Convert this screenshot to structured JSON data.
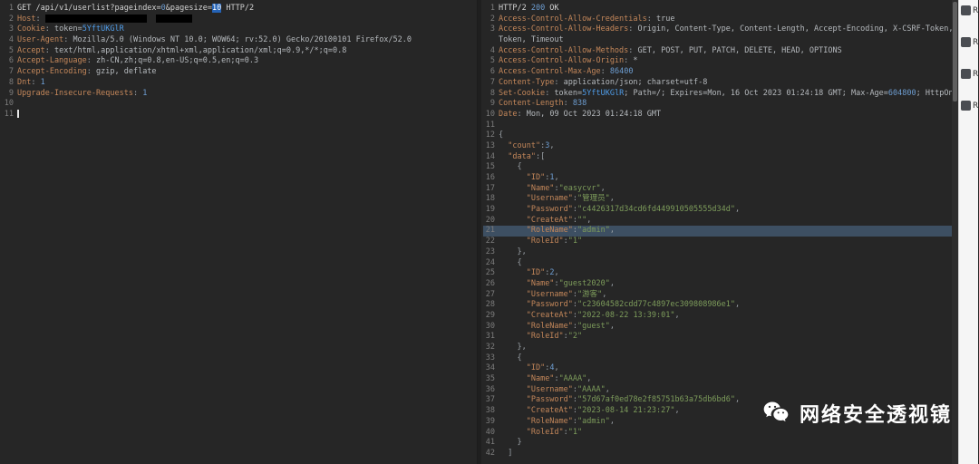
{
  "request": {
    "lines": [
      {
        "n": "1",
        "t": [
          [
            "GET ",
            "p"
          ],
          [
            "/api/v1/userlist?",
            "p"
          ],
          [
            "pageindex=",
            "p"
          ],
          [
            "0",
            "num"
          ],
          [
            "&pagesize=",
            "p"
          ],
          [
            "10",
            "selv"
          ],
          [
            " HTTP/2",
            "p"
          ]
        ]
      },
      {
        "n": "2",
        "t": [
          [
            "Host",
            "hn"
          ],
          [
            ": ",
            "pu"
          ],
          [
            "",
            "rd",
            112
          ],
          [
            "  ",
            "pu"
          ],
          [
            "",
            "rd",
            40
          ]
        ]
      },
      {
        "n": "3",
        "t": [
          [
            "Cookie",
            "hn"
          ],
          [
            ": ",
            "pu"
          ],
          [
            "token=",
            "v"
          ],
          [
            "5YftUKGlR",
            "tok"
          ]
        ]
      },
      {
        "n": "4",
        "t": [
          [
            "User-Agent",
            "hn"
          ],
          [
            ": ",
            "pu"
          ],
          [
            "Mozilla/5.0 (Windows NT 10.0; WOW64; rv:52.0) Gecko/20100101 Firefox/52.0",
            "v"
          ]
        ]
      },
      {
        "n": "5",
        "t": [
          [
            "Accept",
            "hn"
          ],
          [
            ": ",
            "pu"
          ],
          [
            "text/html,application/xhtml+xml,application/xml;q=0.9,*/*;q=0.8",
            "v"
          ]
        ]
      },
      {
        "n": "6",
        "t": [
          [
            "Accept-Language",
            "hn"
          ],
          [
            ": ",
            "pu"
          ],
          [
            "zh-CN,zh;q=0.8,en-US;q=0.5,en;q=0.3",
            "v"
          ]
        ]
      },
      {
        "n": "7",
        "t": [
          [
            "Accept-Encoding",
            "hn"
          ],
          [
            ": ",
            "pu"
          ],
          [
            "gzip, deflate",
            "v"
          ]
        ]
      },
      {
        "n": "8",
        "t": [
          [
            "Dnt",
            "hn"
          ],
          [
            ": ",
            "pu"
          ],
          [
            "1",
            "num"
          ]
        ]
      },
      {
        "n": "9",
        "t": [
          [
            "Upgrade-Insecure-Requests",
            "hn"
          ],
          [
            ": ",
            "pu"
          ],
          [
            "1",
            "num"
          ]
        ]
      },
      {
        "n": "10",
        "t": []
      },
      {
        "n": "11",
        "t": [],
        "cursor": true
      }
    ]
  },
  "response": {
    "lines": [
      {
        "n": "1",
        "t": [
          [
            "HTTP/2 ",
            "p"
          ],
          [
            "200",
            "num"
          ],
          [
            " OK",
            "p"
          ]
        ]
      },
      {
        "n": "2",
        "t": [
          [
            "Access-Control-Allow-Credentials",
            "hn"
          ],
          [
            ": ",
            "pu"
          ],
          [
            "true",
            "v"
          ]
        ]
      },
      {
        "n": "3",
        "t": [
          [
            "Access-Control-Allow-Headers",
            "hn"
          ],
          [
            ": ",
            "pu"
          ],
          [
            "Origin, Content-Type, Content-Length, Accept-Encoding, X-CSRF-Token,",
            "v"
          ]
        ]
      },
      {
        "n": "",
        "t": [
          [
            "Token, Timeout",
            "v"
          ]
        ]
      },
      {
        "n": "4",
        "t": [
          [
            "Access-Control-Allow-Methods",
            "hn"
          ],
          [
            ": ",
            "pu"
          ],
          [
            "GET, POST, PUT, PATCH, DELETE, HEAD, OPTIONS",
            "v"
          ]
        ]
      },
      {
        "n": "5",
        "t": [
          [
            "Access-Control-Allow-Origin",
            "hn"
          ],
          [
            ": ",
            "pu"
          ],
          [
            "*",
            "v"
          ]
        ]
      },
      {
        "n": "6",
        "t": [
          [
            "Access-Control-Max-Age",
            "hn"
          ],
          [
            ": ",
            "pu"
          ],
          [
            "86400",
            "num"
          ]
        ]
      },
      {
        "n": "7",
        "t": [
          [
            "Content-Type",
            "hn"
          ],
          [
            ": ",
            "pu"
          ],
          [
            "application/json; charset=utf-8",
            "v"
          ]
        ]
      },
      {
        "n": "8",
        "t": [
          [
            "Set-Cookie",
            "hn"
          ],
          [
            ": ",
            "pu"
          ],
          [
            "token=",
            "v"
          ],
          [
            "5YftUKGlR",
            "tok"
          ],
          [
            "; Path=/; Expires=Mon, 16 Oct 2023 01:24:18 GMT; Max-Age=",
            "v"
          ],
          [
            "604800",
            "num"
          ],
          [
            "; HttpOnly",
            "v"
          ]
        ]
      },
      {
        "n": "9",
        "t": [
          [
            "Content-Length",
            "hn"
          ],
          [
            ": ",
            "pu"
          ],
          [
            "838",
            "num"
          ]
        ]
      },
      {
        "n": "10",
        "t": [
          [
            "Date",
            "hn"
          ],
          [
            ": ",
            "pu"
          ],
          [
            "Mon, 09 Oct 2023 01:24:18 GMT",
            "v"
          ]
        ]
      },
      {
        "n": "11",
        "t": []
      },
      {
        "n": "12",
        "t": [
          [
            "{",
            "pu"
          ]
        ]
      },
      {
        "n": "13",
        "t": [
          [
            "  ",
            "p"
          ],
          [
            "\"count\"",
            "key"
          ],
          [
            ":",
            "pu"
          ],
          [
            "3",
            "num"
          ],
          [
            ",",
            "pu"
          ]
        ]
      },
      {
        "n": "14",
        "t": [
          [
            "  ",
            "p"
          ],
          [
            "\"data\"",
            "key"
          ],
          [
            ":[",
            "pu"
          ]
        ]
      },
      {
        "n": "15",
        "t": [
          [
            "    {",
            "pu"
          ]
        ]
      },
      {
        "n": "16",
        "t": [
          [
            "      ",
            "p"
          ],
          [
            "\"ID\"",
            "key"
          ],
          [
            ":",
            "pu"
          ],
          [
            "1",
            "num"
          ],
          [
            ",",
            "pu"
          ]
        ]
      },
      {
        "n": "17",
        "t": [
          [
            "      ",
            "p"
          ],
          [
            "\"Name\"",
            "key"
          ],
          [
            ":",
            "pu"
          ],
          [
            "\"easycvr\"",
            "str"
          ],
          [
            ",",
            "pu"
          ]
        ]
      },
      {
        "n": "18",
        "t": [
          [
            "      ",
            "p"
          ],
          [
            "\"Username\"",
            "key"
          ],
          [
            ":",
            "pu"
          ],
          [
            "\"管理员\"",
            "str"
          ],
          [
            ",",
            "pu"
          ]
        ]
      },
      {
        "n": "19",
        "t": [
          [
            "      ",
            "p"
          ],
          [
            "\"Password\"",
            "key"
          ],
          [
            ":",
            "pu"
          ],
          [
            "\"c4426317d34cd6fd449910505555d34d\"",
            "str"
          ],
          [
            ",",
            "pu"
          ]
        ]
      },
      {
        "n": "20",
        "t": [
          [
            "      ",
            "p"
          ],
          [
            "\"CreateAt\"",
            "key"
          ],
          [
            ":",
            "pu"
          ],
          [
            "\"\"",
            "str"
          ],
          [
            ",",
            "pu"
          ]
        ]
      },
      {
        "n": "21",
        "hl": true,
        "t": [
          [
            "      ",
            "p"
          ],
          [
            "\"RoleName\"",
            "key"
          ],
          [
            ":",
            "pu"
          ],
          [
            "\"admin\"",
            "str"
          ],
          [
            ",",
            "pu"
          ]
        ]
      },
      {
        "n": "22",
        "t": [
          [
            "      ",
            "p"
          ],
          [
            "\"RoleId\"",
            "key"
          ],
          [
            ":",
            "pu"
          ],
          [
            "\"1\"",
            "str"
          ]
        ]
      },
      {
        "n": "23",
        "t": [
          [
            "    },",
            "pu"
          ]
        ]
      },
      {
        "n": "24",
        "t": [
          [
            "    {",
            "pu"
          ]
        ]
      },
      {
        "n": "25",
        "t": [
          [
            "      ",
            "p"
          ],
          [
            "\"ID\"",
            "key"
          ],
          [
            ":",
            "pu"
          ],
          [
            "2",
            "num"
          ],
          [
            ",",
            "pu"
          ]
        ]
      },
      {
        "n": "26",
        "t": [
          [
            "      ",
            "p"
          ],
          [
            "\"Name\"",
            "key"
          ],
          [
            ":",
            "pu"
          ],
          [
            "\"guest2020\"",
            "str"
          ],
          [
            ",",
            "pu"
          ]
        ]
      },
      {
        "n": "27",
        "t": [
          [
            "      ",
            "p"
          ],
          [
            "\"Username\"",
            "key"
          ],
          [
            ":",
            "pu"
          ],
          [
            "\"游客\"",
            "str"
          ],
          [
            ",",
            "pu"
          ]
        ]
      },
      {
        "n": "28",
        "t": [
          [
            "      ",
            "p"
          ],
          [
            "\"Password\"",
            "key"
          ],
          [
            ":",
            "pu"
          ],
          [
            "\"c23604582cdd77c4897ec309808986e1\"",
            "str"
          ],
          [
            ",",
            "pu"
          ]
        ]
      },
      {
        "n": "29",
        "t": [
          [
            "      ",
            "p"
          ],
          [
            "\"CreateAt\"",
            "key"
          ],
          [
            ":",
            "pu"
          ],
          [
            "\"2022-08-22 13:39:01\"",
            "str"
          ],
          [
            ",",
            "pu"
          ]
        ]
      },
      {
        "n": "30",
        "t": [
          [
            "      ",
            "p"
          ],
          [
            "\"RoleName\"",
            "key"
          ],
          [
            ":",
            "pu"
          ],
          [
            "\"guest\"",
            "str"
          ],
          [
            ",",
            "pu"
          ]
        ]
      },
      {
        "n": "31",
        "t": [
          [
            "      ",
            "p"
          ],
          [
            "\"RoleId\"",
            "key"
          ],
          [
            ":",
            "pu"
          ],
          [
            "\"2\"",
            "str"
          ]
        ]
      },
      {
        "n": "32",
        "t": [
          [
            "    },",
            "pu"
          ]
        ]
      },
      {
        "n": "33",
        "t": [
          [
            "    {",
            "pu"
          ]
        ]
      },
      {
        "n": "34",
        "t": [
          [
            "      ",
            "p"
          ],
          [
            "\"ID\"",
            "key"
          ],
          [
            ":",
            "pu"
          ],
          [
            "4",
            "num"
          ],
          [
            ",",
            "pu"
          ]
        ]
      },
      {
        "n": "35",
        "t": [
          [
            "      ",
            "p"
          ],
          [
            "\"Name\"",
            "key"
          ],
          [
            ":",
            "pu"
          ],
          [
            "\"AAAA\"",
            "str"
          ],
          [
            ",",
            "pu"
          ]
        ]
      },
      {
        "n": "36",
        "t": [
          [
            "      ",
            "p"
          ],
          [
            "\"Username\"",
            "key"
          ],
          [
            ":",
            "pu"
          ],
          [
            "\"AAAA\"",
            "str"
          ],
          [
            ",",
            "pu"
          ]
        ]
      },
      {
        "n": "37",
        "t": [
          [
            "      ",
            "p"
          ],
          [
            "\"Password\"",
            "key"
          ],
          [
            ":",
            "pu"
          ],
          [
            "\"57d67af0ed78e2f85751b63a75db6bd6\"",
            "str"
          ],
          [
            ",",
            "pu"
          ]
        ]
      },
      {
        "n": "38",
        "t": [
          [
            "      ",
            "p"
          ],
          [
            "\"CreateAt\"",
            "key"
          ],
          [
            ":",
            "pu"
          ],
          [
            "\"2023-08-14 21:23:27\"",
            "str"
          ],
          [
            ",",
            "pu"
          ]
        ]
      },
      {
        "n": "39",
        "t": [
          [
            "      ",
            "p"
          ],
          [
            "\"RoleName\"",
            "key"
          ],
          [
            ":",
            "pu"
          ],
          [
            "\"admin\"",
            "str"
          ],
          [
            ",",
            "pu"
          ]
        ]
      },
      {
        "n": "40",
        "t": [
          [
            "      ",
            "p"
          ],
          [
            "\"RoleId\"",
            "key"
          ],
          [
            ":",
            "pu"
          ],
          [
            "\"1\"",
            "str"
          ]
        ]
      },
      {
        "n": "41",
        "t": [
          [
            "    }",
            "pu"
          ]
        ]
      },
      {
        "n": "42",
        "t": [
          [
            "  ]",
            "pu"
          ]
        ]
      }
    ]
  },
  "inspector": {
    "items": [
      {
        "label": "Re"
      },
      {
        "label": "Re"
      },
      {
        "label": "Re"
      },
      {
        "label": "Re"
      }
    ]
  },
  "watermark": {
    "text": "网络安全透视镜"
  },
  "colors": {
    "background": "#262626",
    "header_name": "#c4875a",
    "json_string": "#7d9c5b",
    "number": "#6d9dd1",
    "token_highlight": "#4f9ce8",
    "selected_line": "#3d4f62"
  }
}
